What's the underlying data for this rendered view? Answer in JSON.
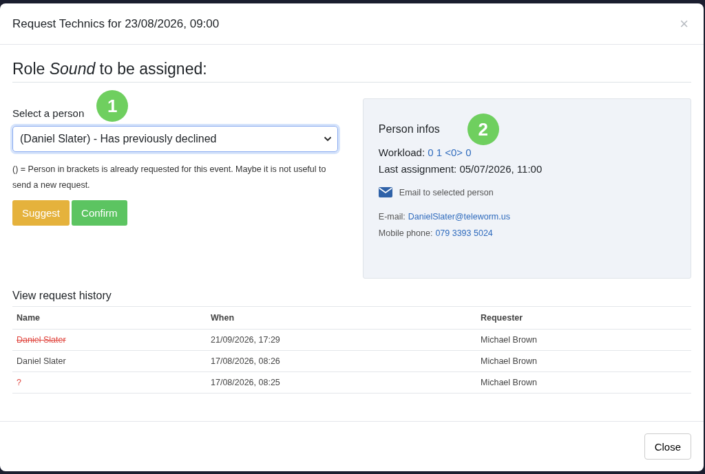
{
  "modal": {
    "title": "Request Technics for 23/08/2026, 09:00",
    "close_icon": "×"
  },
  "heading": "Role *Sound* to be assigned:",
  "select": {
    "label": "Select a person",
    "value": "(Daniel Slater) - Has previously declined",
    "badge": "1"
  },
  "hint": "() = Person in brackets is already requested for this event. Maybe it is not useful to send a new request.",
  "buttons": [
    {
      "label": "Suggest",
      "kind": "warning"
    },
    {
      "label": "Confirm",
      "kind": "success"
    }
  ],
  "person_infos": {
    "title": "Person infos",
    "badge": "2",
    "workload_label": "Workload:",
    "workload_value": "0 1 <0> 0",
    "last_assignment": "Last assignment: 05/07/2026, 11:00",
    "email_action": "Email to selected person",
    "email_label": "E-mail:",
    "email": "DanielSlater@teleworm.us",
    "phone_label": "Mobile phone:",
    "phone": "079 3393 5024"
  },
  "history": {
    "title": "View request history",
    "columns": [
      "Name",
      "When",
      "Requester"
    ],
    "rows": [
      {
        "name": "Daniel Slater",
        "when": "21/09/2026, 17:29",
        "requester": "Michael Brown",
        "kind": "declined"
      },
      {
        "name": "Daniel Slater",
        "when": "17/08/2026, 08:26",
        "requester": "Michael Brown",
        "kind": "normal"
      },
      {
        "name": "?",
        "when": "17/08/2026, 08:25",
        "requester": "Michael Brown",
        "kind": "unknown"
      }
    ]
  },
  "footer": {
    "close": "Close"
  }
}
